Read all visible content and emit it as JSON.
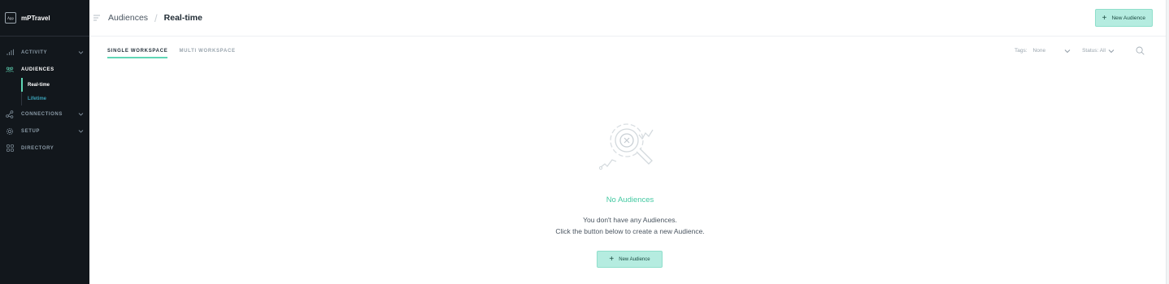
{
  "sidebar": {
    "logo_text": "App",
    "brand": "mPTravel",
    "items": [
      {
        "label": "ACTIVITY",
        "icon": "chart-icon"
      },
      {
        "label": "AUDIENCES",
        "icon": "users-icon"
      },
      {
        "label": "CONNECTIONS",
        "icon": "connections-icon"
      },
      {
        "label": "SETUP",
        "icon": "gear-icon"
      },
      {
        "label": "DIRECTORY",
        "icon": "grid-icon"
      }
    ],
    "subitems": [
      {
        "label": "Real-time"
      },
      {
        "label": "Lifetime"
      }
    ]
  },
  "header": {
    "breadcrumb_parent": "Audiences",
    "breadcrumb_sep": "/",
    "breadcrumb_current": "Real-time",
    "new_button_label": "New Audience"
  },
  "tabs": [
    {
      "label": "SINGLE WORKSPACE"
    },
    {
      "label": "MULTI WORKSPACE"
    }
  ],
  "filters": {
    "tags_label": "Tags:",
    "tags_value": "None",
    "status_label": "Status: All"
  },
  "empty": {
    "title": "No Audiences",
    "line1": "You don't have any Audiences.",
    "line2": "Click the button below to create a new Audience.",
    "button_label": "New Audience"
  },
  "colors": {
    "sidebar_bg": "#12171c",
    "accent": "#5fd6b5",
    "button_bg": "#b5ece0",
    "empty_title": "#44c9a2",
    "sub_link": "#3aa0b6"
  }
}
